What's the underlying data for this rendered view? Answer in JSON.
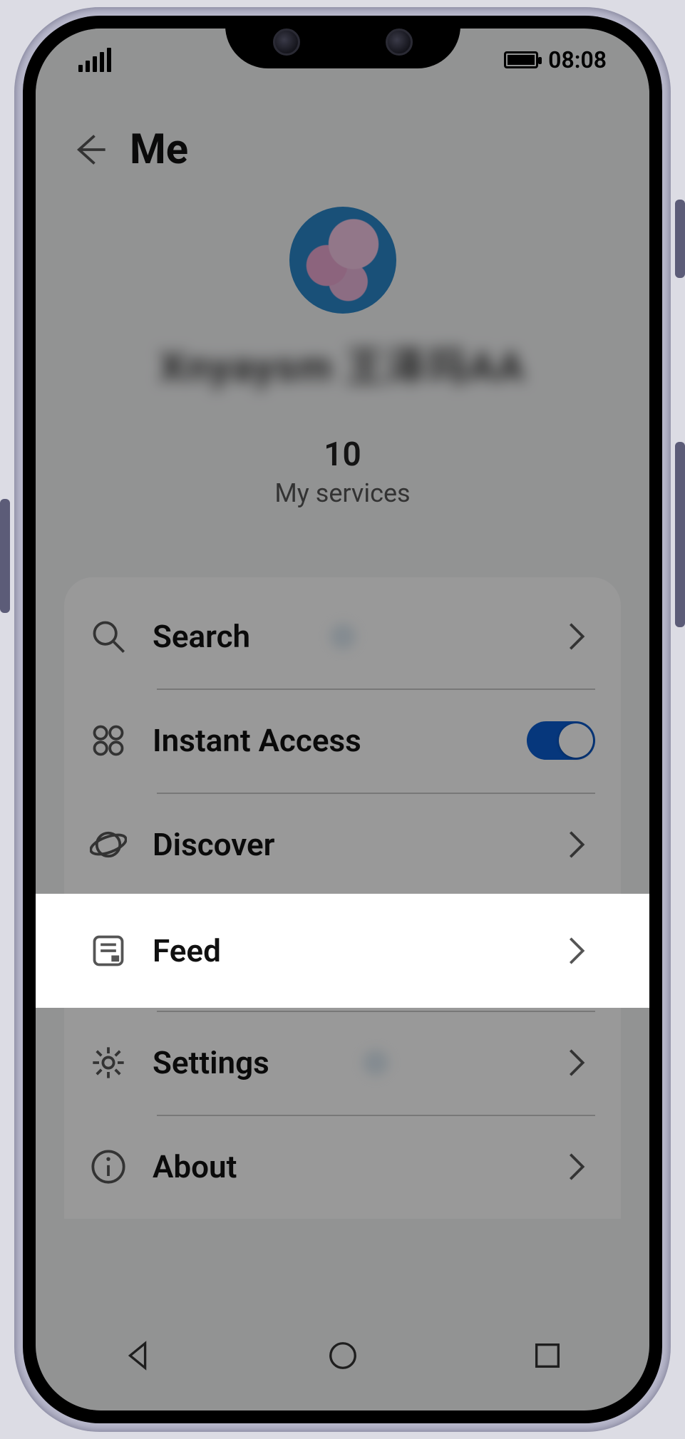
{
  "status": {
    "time": "08:08"
  },
  "header": {
    "title": "Me"
  },
  "profile": {
    "username_masked": "Xnyaysm  王泽玛AA",
    "services_count": "10",
    "services_label": "My services"
  },
  "menu": {
    "search": {
      "label": "Search"
    },
    "instant_access": {
      "label": "Instant Access",
      "on": true
    },
    "discover": {
      "label": "Discover"
    },
    "feed": {
      "label": "Feed"
    },
    "settings": {
      "label": "Settings"
    },
    "about": {
      "label": "About"
    }
  }
}
